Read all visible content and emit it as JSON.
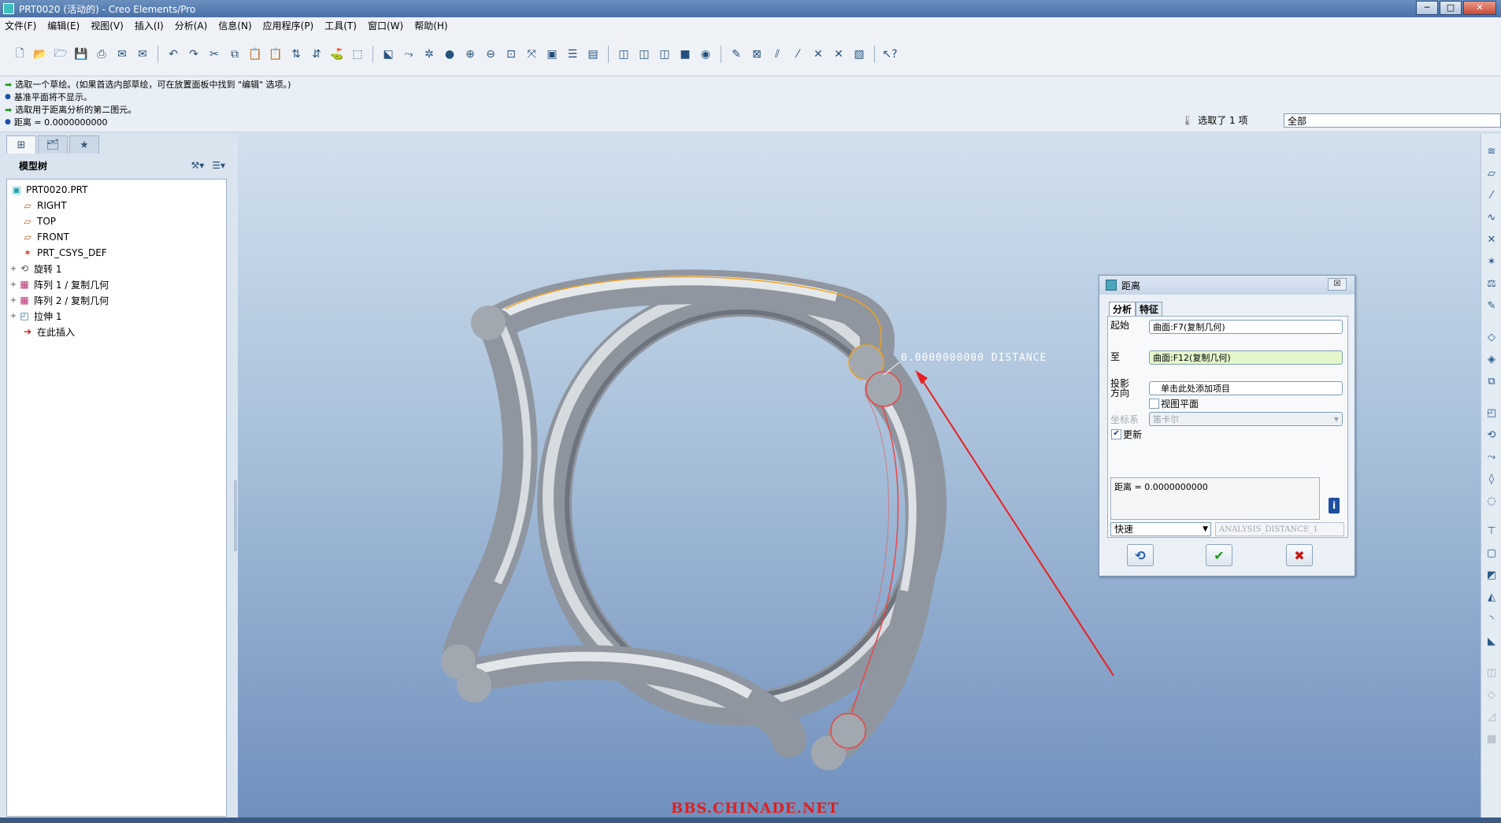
{
  "window": {
    "title": "PRT0020 (活动的) - Creo Elements/Pro"
  },
  "menu": [
    "文件(F)",
    "编辑(E)",
    "视图(V)",
    "插入(I)",
    "分析(A)",
    "信息(N)",
    "应用程序(P)",
    "工具(T)",
    "窗口(W)",
    "帮助(H)"
  ],
  "messages": [
    {
      "kind": "prompt",
      "text": "选取一个草绘。(如果首选内部草绘，可在放置面板中找到 \"编辑\" 选项。)"
    },
    {
      "kind": "info",
      "text": "基准平面将不显示。"
    },
    {
      "kind": "prompt",
      "text": "选取用于距离分析的第二图元。"
    },
    {
      "kind": "info",
      "text": "距离 = 0.0000000000"
    }
  ],
  "selection": {
    "status": "选取了 1 项",
    "filter": "全部"
  },
  "model_tree": {
    "title": "模型树",
    "items": [
      {
        "label": "PRT0020.PRT",
        "icon": "part-icon",
        "expand": ""
      },
      {
        "label": "RIGHT",
        "icon": "datum-plane-icon",
        "expand": ""
      },
      {
        "label": "TOP",
        "icon": "datum-plane-icon",
        "expand": ""
      },
      {
        "label": "FRONT",
        "icon": "datum-plane-icon",
        "expand": ""
      },
      {
        "label": "PRT_CSYS_DEF",
        "icon": "csys-icon",
        "expand": ""
      },
      {
        "label": "旋转 1",
        "icon": "revolve-icon",
        "expand": "+"
      },
      {
        "label": "阵列 1 / 复制几何",
        "icon": "pattern-icon",
        "expand": "+"
      },
      {
        "label": "阵列 2 / 复制几何",
        "icon": "pattern-icon",
        "expand": "+"
      },
      {
        "label": "拉伸 1",
        "icon": "extrude-icon",
        "expand": "+"
      },
      {
        "label": "在此插入",
        "icon": "insert-here-icon",
        "expand": ""
      }
    ]
  },
  "viewport": {
    "distance_label": "0.0000000000  DISTANCE",
    "watermark": "BBS.CHINADE.NET"
  },
  "dialog": {
    "title": "距离",
    "close": "☒",
    "tabs": [
      "分析",
      "特征"
    ],
    "from_label": "起始",
    "from_value": "曲面:F7(复制几何)",
    "to_label": "至",
    "to_value": "曲面:F12(复制几何)",
    "proj_label": "投影方向",
    "proj_value": "单击此处添加项目",
    "view_plane_label": "视图平面",
    "csys_label": "坐标系",
    "csys_value": "笛卡尔",
    "update_label": "更新",
    "result": "距离 = 0.0000000000",
    "mode": "快速",
    "analysis_name": "ANALYSIS_DISTANCE_1",
    "buttons": {
      "repeat": "⟲",
      "ok": "✔",
      "cancel": "✖"
    }
  },
  "colors": {
    "highlight_orange": "#f0a020",
    "highlight_red": "#e84848",
    "arrow": "#e82020",
    "ok_green": "#1a9a1a",
    "cancel_red": "#cc1111"
  }
}
